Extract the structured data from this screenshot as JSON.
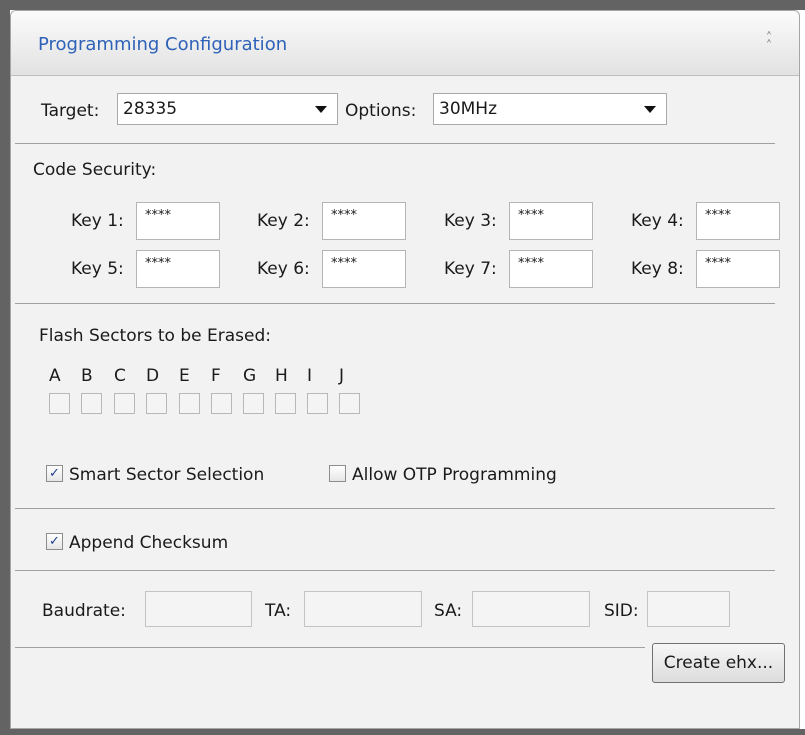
{
  "panel": {
    "title": "Programming Configuration"
  },
  "target": {
    "label": "Target:",
    "value": "28335"
  },
  "options": {
    "label": "Options:",
    "value": "30MHz"
  },
  "code_security": {
    "heading": "Code Security:",
    "keys": [
      {
        "label": "Key 1:",
        "value": "****"
      },
      {
        "label": "Key 2:",
        "value": "****"
      },
      {
        "label": "Key 3:",
        "value": "****"
      },
      {
        "label": "Key 4:",
        "value": "****"
      },
      {
        "label": "Key 5:",
        "value": "****"
      },
      {
        "label": "Key 6:",
        "value": "****"
      },
      {
        "label": "Key 7:",
        "value": "****"
      },
      {
        "label": "Key 8:",
        "value": "****"
      }
    ]
  },
  "flash": {
    "heading": "Flash Sectors to be Erased:",
    "sectors": [
      "A",
      "B",
      "C",
      "D",
      "E",
      "F",
      "G",
      "H",
      "I",
      "J"
    ],
    "checked": [
      false,
      false,
      false,
      false,
      false,
      false,
      false,
      false,
      false,
      false
    ]
  },
  "smart_sector": {
    "label": "Smart Sector Selection",
    "checked": true
  },
  "allow_otp": {
    "label": "Allow OTP Programming",
    "checked": false
  },
  "append_checksum": {
    "label": "Append Checksum",
    "checked": true
  },
  "comm": {
    "baudrate_label": "Baudrate:",
    "ta_label": "TA:",
    "sa_label": "SA:",
    "sid_label": "SID:",
    "baudrate_value": "",
    "ta_value": "",
    "sa_value": "",
    "sid_value": ""
  },
  "actions": {
    "create_label": "Create ehx..."
  },
  "icons": {
    "collapse": "double-chevron-up-icon",
    "dropdown": "triangle-down-icon",
    "check": "checkmark-icon"
  },
  "colors": {
    "title": "#2e62b8",
    "frame": "#636363",
    "panel_bg": "#f2f2f2"
  }
}
